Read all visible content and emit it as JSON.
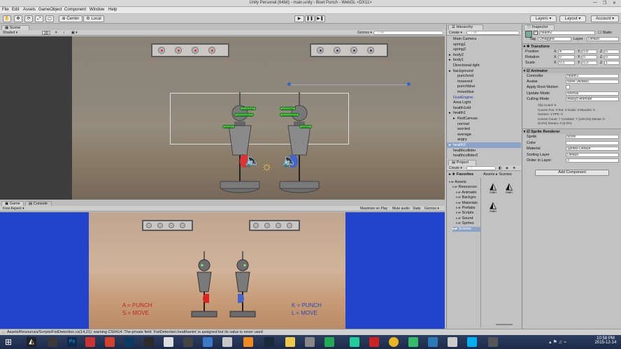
{
  "window": {
    "title": "Unity Personal (64bit) - main.unity - Boet Punch - WebGL <DX11>"
  },
  "menu": [
    "File",
    "Edit",
    "Assets",
    "GameObject",
    "Component",
    "Window",
    "Help"
  ],
  "toolbar": {
    "center_label": "Center",
    "local_label": "Local",
    "layers_label": "Layers",
    "layout_label": "Layout",
    "account_label": "Account"
  },
  "scene_tab": {
    "label": "Scene",
    "shading": "Shaded",
    "mode": "2D",
    "gizmos": "Gizmos",
    "search_placeholder": "All"
  },
  "game_tab": {
    "label": "Game",
    "console_label": "Console",
    "aspect": "Free Aspect",
    "maximize": "Maximize on Play",
    "mute": "Mute audio",
    "stats": "Stats",
    "gizmos": "Gizmos"
  },
  "scene_labels": [
    "punchstill",
    "movecontrol",
    "weight"
  ],
  "game_text": {
    "left_controls": "A = PUNCH\nS = MOVE",
    "right_controls": "K = PUNCH\nL = MOVE"
  },
  "hierarchy": {
    "label": "Hierarchy",
    "create": "Create",
    "search_placeholder": "All",
    "items": [
      {
        "text": "Main Camera",
        "indent": 0,
        "arrow": false
      },
      {
        "text": "spring1",
        "indent": 0,
        "arrow": false
      },
      {
        "text": "spring2",
        "indent": 0,
        "arrow": false
      },
      {
        "text": "body2",
        "indent": 0,
        "arrow": true
      },
      {
        "text": "body1",
        "indent": 0,
        "arrow": true
      },
      {
        "text": "Directional light",
        "indent": 0,
        "arrow": false
      },
      {
        "text": "background",
        "indent": 0,
        "arrow": true
      },
      {
        "text": "punchred",
        "indent": 1,
        "arrow": false
      },
      {
        "text": "movered",
        "indent": 1,
        "arrow": false
      },
      {
        "text": "punchblue",
        "indent": 1,
        "arrow": false
      },
      {
        "text": "moveblue",
        "indent": 1,
        "arrow": false
      },
      {
        "text": "DustEngine",
        "indent": 0,
        "arrow": false,
        "blue": true
      },
      {
        "text": "Area Light",
        "indent": 0,
        "arrow": false
      },
      {
        "text": "health1old",
        "indent": 0,
        "arrow": false
      },
      {
        "text": "health1",
        "indent": 0,
        "arrow": true
      },
      {
        "text": "RedCanvas",
        "indent": 1,
        "arrow": true
      },
      {
        "text": "normal",
        "indent": 1,
        "arrow": false
      },
      {
        "text": "worried",
        "indent": 1,
        "arrow": false
      },
      {
        "text": "average",
        "indent": 1,
        "arrow": false
      },
      {
        "text": "angry",
        "indent": 1,
        "arrow": false
      },
      {
        "text": "health2",
        "indent": 0,
        "arrow": true,
        "sel": true
      },
      {
        "text": "healthcollider",
        "indent": 0,
        "arrow": false
      },
      {
        "text": "healthcollider2",
        "indent": 0,
        "arrow": false
      }
    ]
  },
  "project": {
    "label": "Project",
    "create": "Create",
    "favorites": "Favorites",
    "breadcrumb": [
      "Assets",
      "Scenes"
    ],
    "tree": [
      {
        "text": "Assets",
        "indent": 0
      },
      {
        "text": "Resources",
        "indent": 1
      },
      {
        "text": "Animatio",
        "indent": 2
      },
      {
        "text": "Backgro",
        "indent": 2
      },
      {
        "text": "Materials",
        "indent": 2
      },
      {
        "text": "Prefabs",
        "indent": 2
      },
      {
        "text": "Scripts",
        "indent": 2
      },
      {
        "text": "Sound",
        "indent": 2
      },
      {
        "text": "Sprites",
        "indent": 2
      },
      {
        "text": "Scenes",
        "indent": 1,
        "sel": true
      }
    ],
    "assets": [
      "main",
      "main",
      "main"
    ]
  },
  "inspector": {
    "label": "Inspector",
    "object_name": "health2",
    "static_label": "Static",
    "tag_label": "Tag",
    "tag_value": "Untagged",
    "layer_label": "Layer",
    "layer_value": "Default",
    "transform": {
      "title": "Transform",
      "position": {
        "label": "Position",
        "x": "4",
        "y": "5.8",
        "z": "0"
      },
      "rotation": {
        "label": "Rotation",
        "x": "0",
        "y": "0",
        "z": "0"
      },
      "scale": {
        "label": "Scale",
        "x": "0.3",
        "y": "0.3",
        "z": "1"
      }
    },
    "animator": {
      "title": "Animator",
      "rows": [
        {
          "label": "Controller",
          "value": "health1"
        },
        {
          "label": "Avatar",
          "value": "None (Avatar)"
        },
        {
          "label": "Apply Root Motion",
          "value": ""
        },
        {
          "label": "Update Mode",
          "value": "Normal"
        },
        {
          "label": "Culling Mode",
          "value": "Always Animate"
        }
      ],
      "info": [
        "Clip Count: 9",
        "Curves Pos: 0 Rot: 0 Scale: 0 Muscles: 0",
        "Generic: 4 PPtr: 0",
        "Curves Count: 7 Constant: 7 (100.0%) Dense: 0",
        "(0.0%) Stream: 0 (0.0%)"
      ]
    },
    "sprite_renderer": {
      "title": "Sprite Renderer",
      "rows": [
        {
          "label": "Sprite",
          "value": "score"
        },
        {
          "label": "Color",
          "value": ""
        },
        {
          "label": "Material",
          "value": "Sprites-Default"
        },
        {
          "label": "Sorting Layer",
          "value": "Default"
        },
        {
          "label": "Order in Layer",
          "value": "3"
        }
      ]
    },
    "add_component": "Add Component"
  },
  "status": {
    "message": "Assets/Resources/Scripts/FistDetection.cs(14,21): warning CS0414: The private field `FistDetection.healthanim' is assigned but its value is never used"
  },
  "taskbar": {
    "time": "10:58 PM",
    "date": "2015-12-14"
  }
}
